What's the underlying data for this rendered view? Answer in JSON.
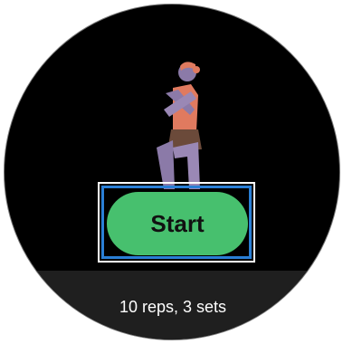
{
  "workout": {
    "start_label": "Start",
    "detail": "10 reps, 3 sets"
  },
  "colors": {
    "background": "#000000",
    "button": "#47c06e",
    "highlight_outer": "#ffffff",
    "highlight_inner": "#2a7fd6",
    "figure_shirt": "#e07a5f",
    "figure_skin": "#8b7aa8"
  }
}
